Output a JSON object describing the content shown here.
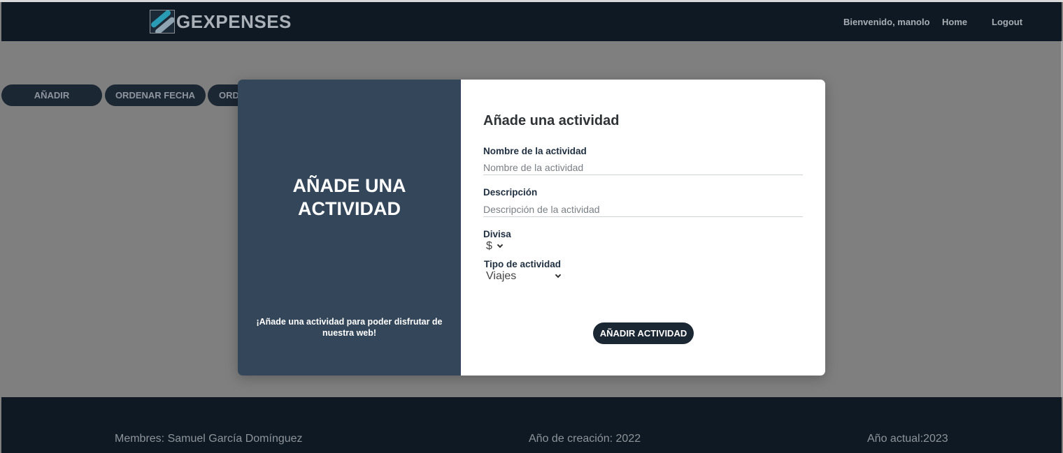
{
  "header": {
    "logo_text": "GEXPENSES",
    "welcome": "Bienvenido, manolo",
    "home": "Home",
    "logout": "Logout"
  },
  "toolbar": {
    "add": "AÑADIR",
    "sort_date": "ORDENAR FECHA",
    "sort_other": "ORD"
  },
  "modal": {
    "left_title": "AÑADE UNA ACTIVIDAD",
    "left_subtitle": "¡Añade una actividad para poder disfrutar de nuestra web!",
    "close": "X",
    "form_title": "Añade una actividad",
    "name_label": "Nombre de la actividad",
    "name_placeholder": "Nombre de la actividad",
    "description_label": "Descripción",
    "description_placeholder": "Descripción de la actividad",
    "currency_label": "Divisa",
    "currency_value": "$",
    "type_label": "Tipo de actividad",
    "type_value": "Viajes",
    "submit": "AÑADIR ACTIVIDAD"
  },
  "footer": {
    "members": "Membres: Samuel García Domínguez",
    "created": "Año de creación: 2022",
    "current": "Año actual:2023"
  }
}
